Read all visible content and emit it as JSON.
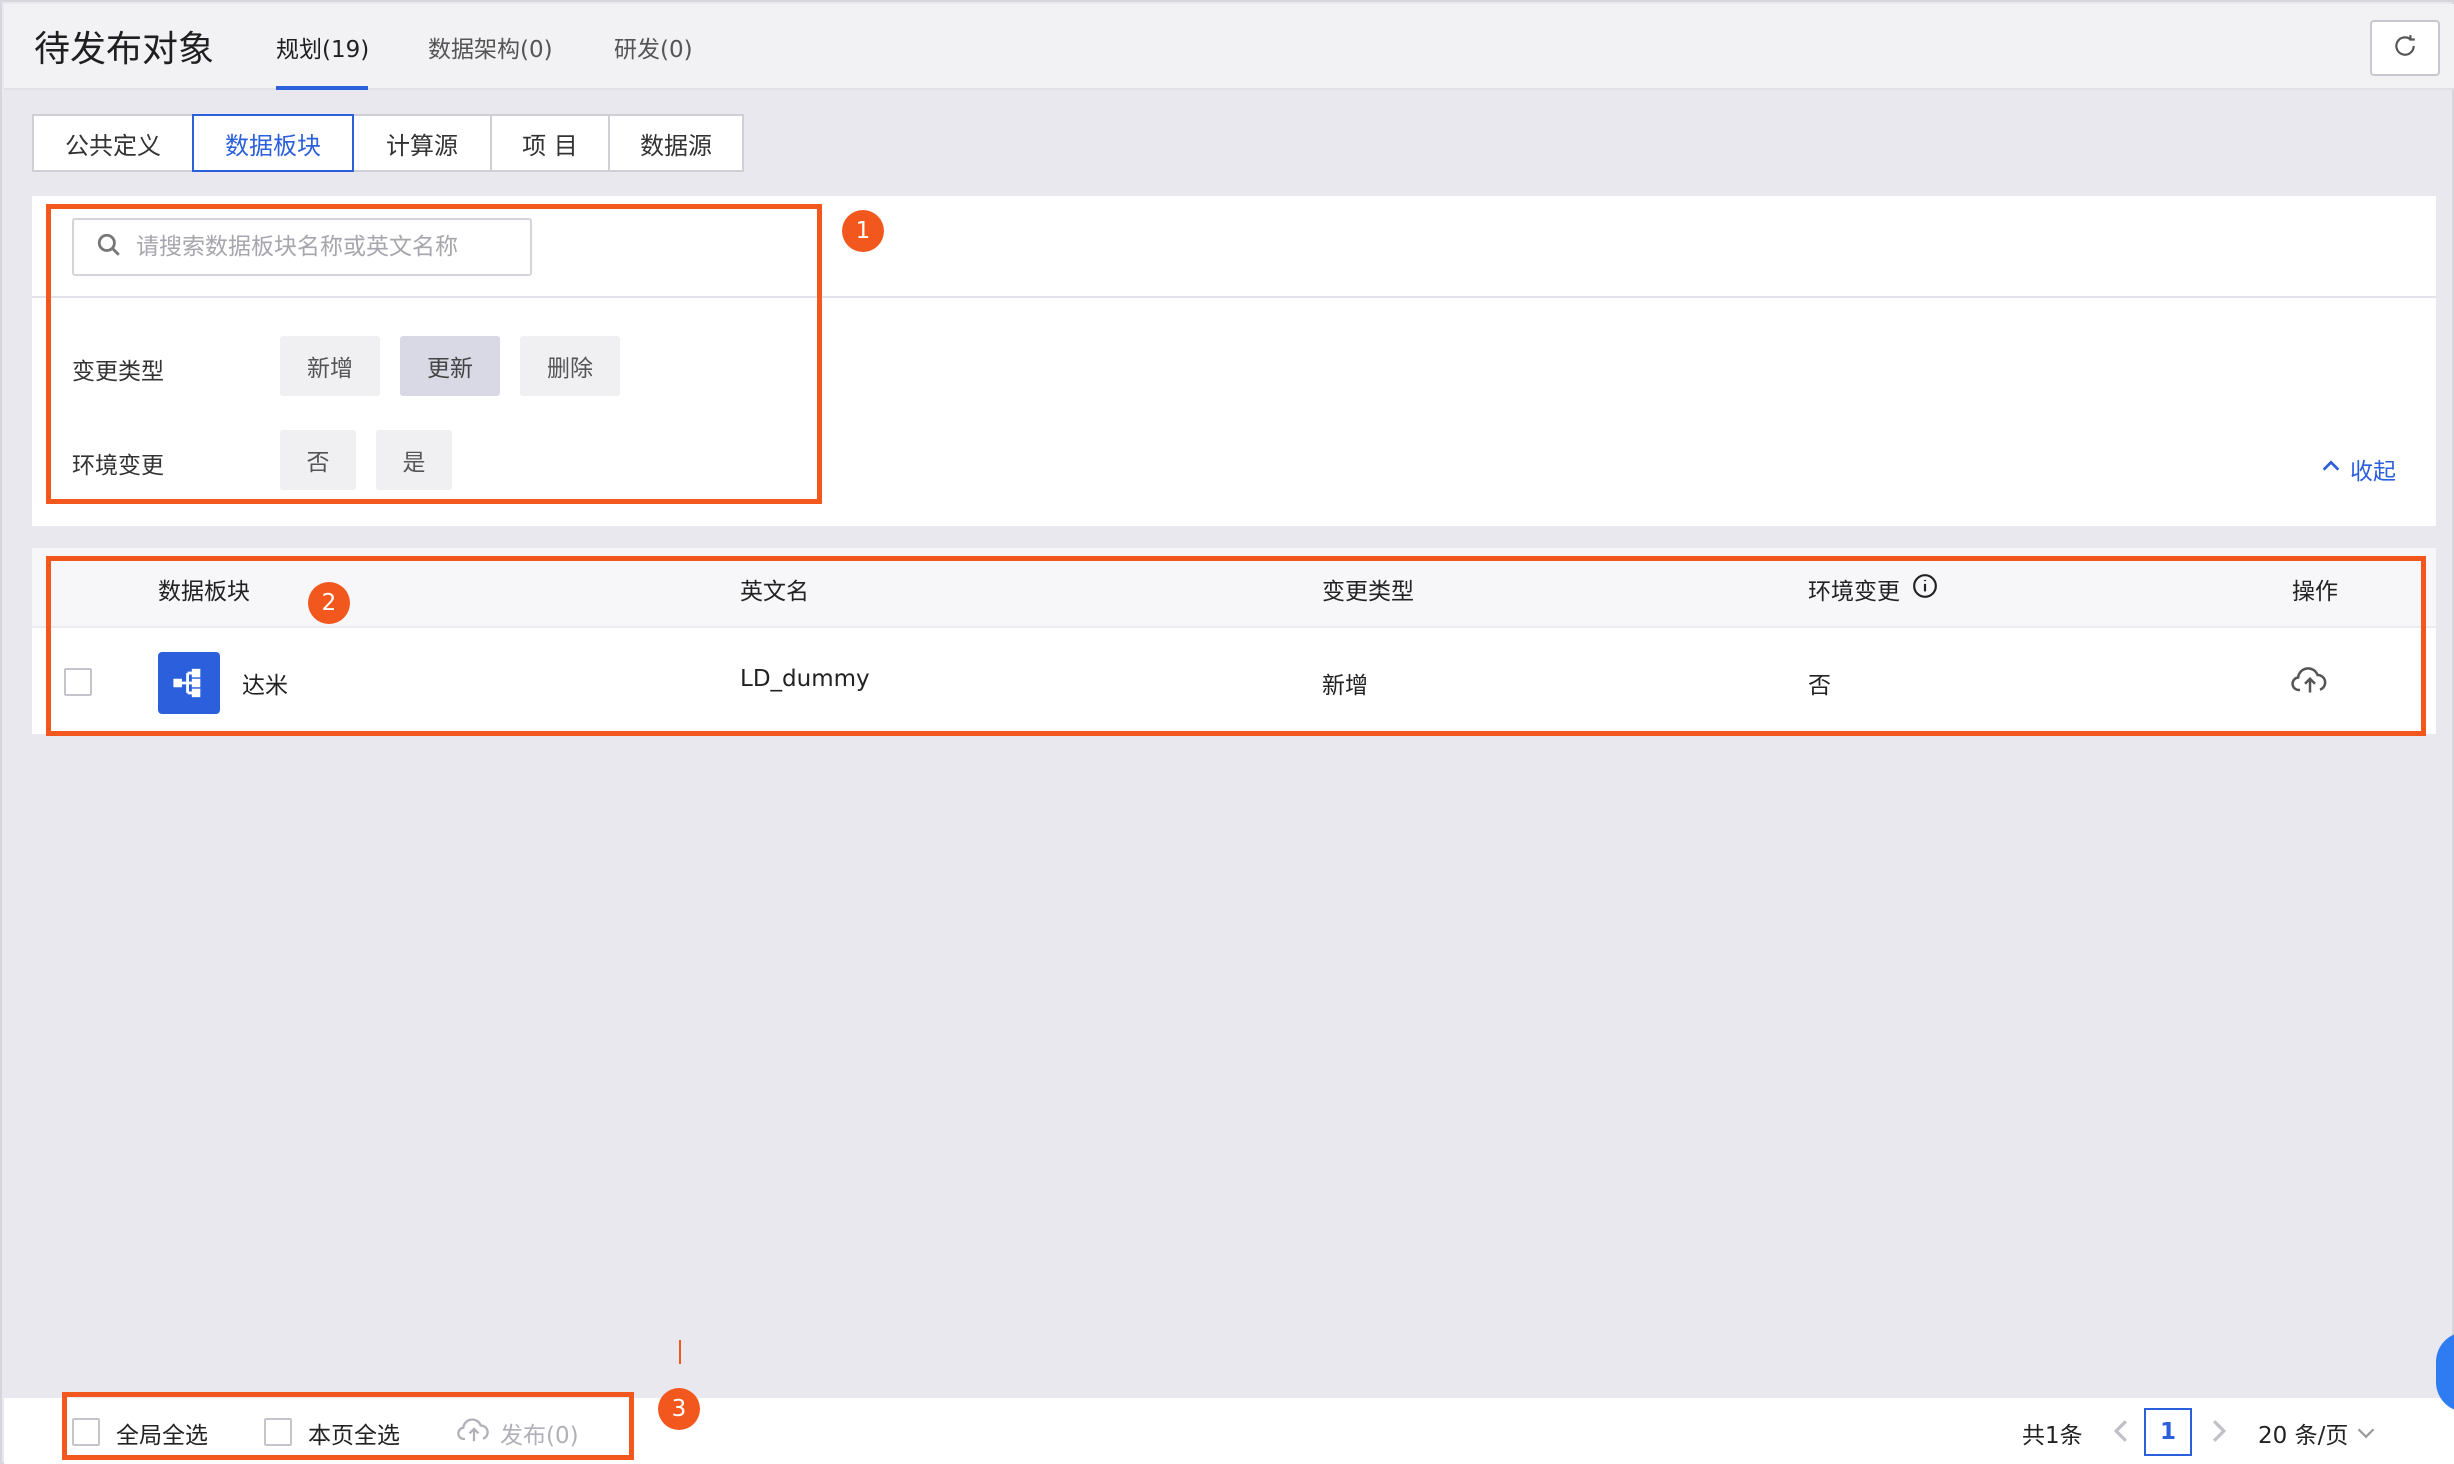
{
  "page": {
    "title": "待发布对象",
    "top_tabs": [
      {
        "label": "规划(19)",
        "active": true
      },
      {
        "label": "数据架构(0)",
        "active": false
      },
      {
        "label": "研发(0)",
        "active": false
      }
    ],
    "refresh_icon": "refresh-icon"
  },
  "sub_tabs": [
    {
      "label": "公共定义",
      "active": false
    },
    {
      "label": "数据板块",
      "active": true
    },
    {
      "label": "计算源",
      "active": false
    },
    {
      "label": "项 目",
      "active": false
    },
    {
      "label": "数据源",
      "active": false
    }
  ],
  "filter": {
    "search_placeholder": "请搜索数据板块名称或英文名称",
    "search_value": "",
    "change_type_label": "变更类型",
    "change_type_options": [
      "新增",
      "更新",
      "删除"
    ],
    "change_type_selected": "更新",
    "env_change_label": "环境变更",
    "env_change_options": [
      "否",
      "是"
    ],
    "collapse_label": "收起"
  },
  "table": {
    "columns": [
      "数据板块",
      "英文名",
      "变更类型",
      "环境变更",
      "操作"
    ],
    "rows": [
      {
        "name": "达米",
        "english_name": "LD_dummy",
        "change_type": "新增",
        "env_change": "否",
        "action_icon": "cloud-upload-icon"
      }
    ]
  },
  "footer": {
    "select_all_global": "全局全选",
    "select_all_page": "本页全选",
    "publish_label": "发布(0)",
    "total": "共1条",
    "current_page": "1",
    "page_size": "20 条/页"
  },
  "annotations": [
    "1",
    "2",
    "3"
  ],
  "colors": {
    "accent": "#2b5fdc",
    "annotation": "#f2581e"
  }
}
